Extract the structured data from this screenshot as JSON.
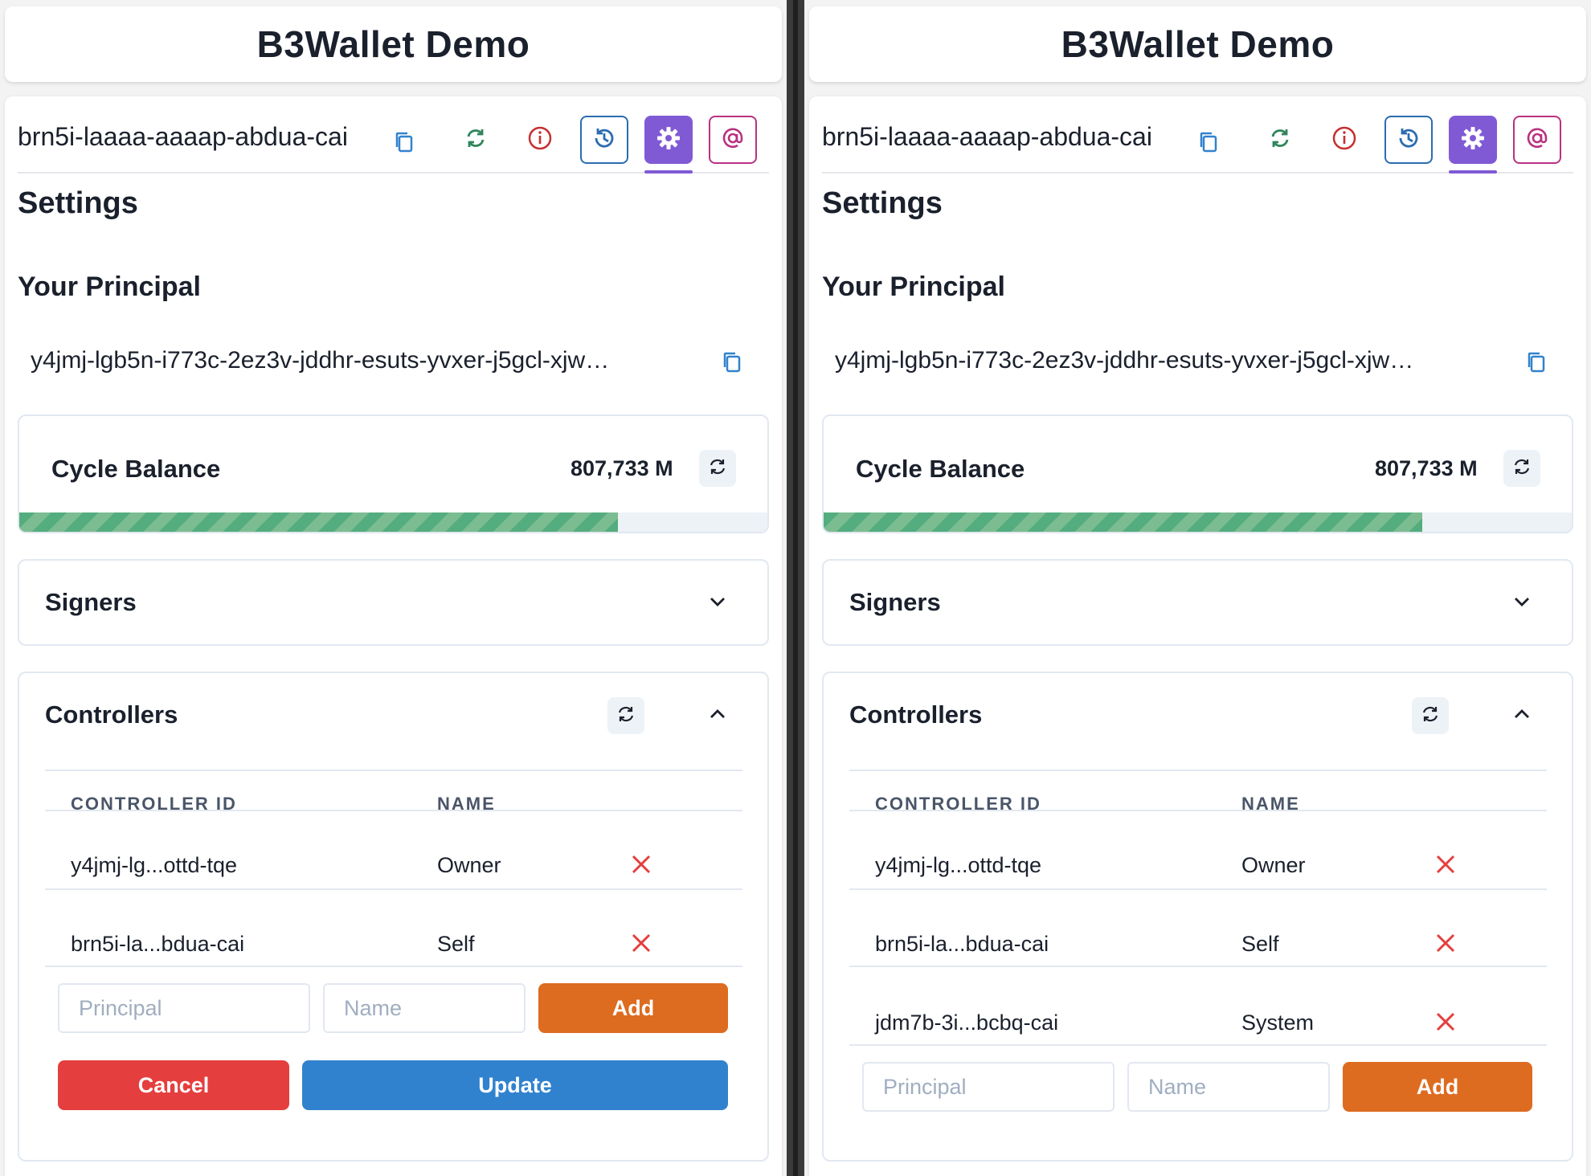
{
  "colors": {
    "accent_purple": "#805ad5",
    "history_blue": "#2b6cb0",
    "pink": "#b83280",
    "refresh_green": "#2f855a",
    "info_red": "#c53030",
    "add_orange": "#dd6b20",
    "cancel_red": "#e53e3e",
    "update_blue": "#3182ce",
    "progress_green": "#38a169"
  },
  "panels": [
    {
      "header": {
        "title": "B3Wallet Demo"
      },
      "topbar": {
        "canister_id": "brn5i-laaaa-aaaap-abdua-cai"
      },
      "settings": {
        "title": "Settings",
        "principal_title": "Your Principal",
        "principal": "y4jmj-lgb5n-i773c-2ez3v-jddhr-esuts-yvxer-j5gcl-xjw…"
      },
      "cycle": {
        "title": "Cycle Balance",
        "value": "807,733 M",
        "fill_fraction": 0.8
      },
      "signers": {
        "title": "Signers"
      },
      "controllers": {
        "title": "Controllers",
        "col_id": "CONTROLLER ID",
        "col_name": "NAME",
        "rows": [
          {
            "id": "y4jmj-lg...ottd-tqe",
            "name": "Owner"
          },
          {
            "id": "brn5i-la...bdua-cai",
            "name": "Self"
          }
        ],
        "principal_placeholder": "Principal",
        "name_placeholder": "Name",
        "add_label": "Add",
        "cancel_label": "Cancel",
        "update_label": "Update"
      }
    },
    {
      "header": {
        "title": "B3Wallet Demo"
      },
      "topbar": {
        "canister_id": "brn5i-laaaa-aaaap-abdua-cai"
      },
      "settings": {
        "title": "Settings",
        "principal_title": "Your Principal",
        "principal": "y4jmj-lgb5n-i773c-2ez3v-jddhr-esuts-yvxer-j5gcl-xjw…"
      },
      "cycle": {
        "title": "Cycle Balance",
        "value": "807,733 M",
        "fill_fraction": 0.8
      },
      "signers": {
        "title": "Signers"
      },
      "controllers": {
        "title": "Controllers",
        "col_id": "CONTROLLER ID",
        "col_name": "NAME",
        "rows": [
          {
            "id": "y4jmj-lg...ottd-tqe",
            "name": "Owner"
          },
          {
            "id": "brn5i-la...bdua-cai",
            "name": "Self"
          },
          {
            "id": "jdm7b-3i...bcbq-cai",
            "name": "System"
          }
        ],
        "principal_placeholder": "Principal",
        "name_placeholder": "Name",
        "add_label": "Add"
      }
    }
  ]
}
